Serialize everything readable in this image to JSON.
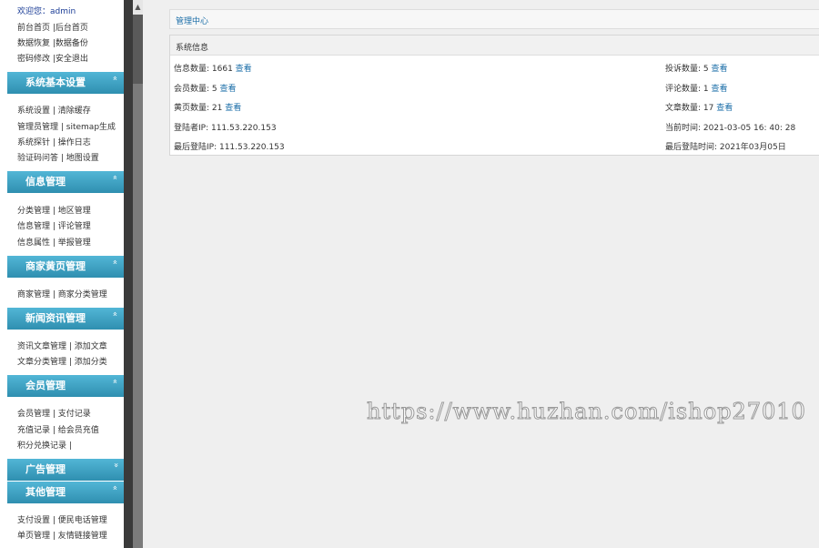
{
  "sidebar": {
    "welcome_prefix": "欢迎您：",
    "welcome_user": "admin",
    "top_links": [
      [
        "前台首页",
        "后台首页"
      ],
      [
        "数据恢复",
        "数据备份"
      ],
      [
        "密码修改",
        "安全退出"
      ]
    ],
    "sections": [
      {
        "title": "系统基本设置",
        "links": [
          [
            "系统设置",
            "清除缓存"
          ],
          [
            "管理员管理",
            "sitemap生成"
          ],
          [
            "系统探针",
            "操作日志"
          ],
          [
            "验证码问答",
            "地图设置"
          ]
        ]
      },
      {
        "title": "信息管理",
        "links": [
          [
            "分类管理",
            "地区管理"
          ],
          [
            "信息管理",
            "评论管理"
          ],
          [
            "信息属性",
            "举报管理"
          ]
        ]
      },
      {
        "title": "商家黄页管理",
        "links": [
          [
            "商家管理",
            "商家分类管理"
          ]
        ]
      },
      {
        "title": "新闻资讯管理",
        "links": [
          [
            "资讯文章管理",
            "添加文章"
          ],
          [
            "文章分类管理",
            "添加分类"
          ]
        ]
      },
      {
        "title": "会员管理",
        "links": [
          [
            "会员管理",
            "支付记录"
          ],
          [
            "充值记录",
            "给会员充值"
          ],
          [
            "积分兑换记录",
            ""
          ]
        ]
      },
      {
        "title": "广告管理",
        "links": []
      },
      {
        "title": "其他管理",
        "links": [
          [
            "支付设置",
            "便民电话管理"
          ],
          [
            "单页管理",
            "友情链接管理"
          ]
        ]
      }
    ],
    "chevron_up": "»",
    "chevron_down": "»"
  },
  "main": {
    "header_title": "管理中心",
    "panel_title": "系统信息",
    "view_label": "查看",
    "rows": [
      {
        "left_label": "信息数量: 1661 ",
        "left_link": "查看",
        "right_label": "投诉数量: 5 ",
        "right_link": "查看"
      },
      {
        "left_label": "会员数量: 5 ",
        "left_link": "查看",
        "right_label": "评论数量: 1 ",
        "right_link": "查看"
      },
      {
        "left_label": "黄页数量: 21 ",
        "left_link": "查看",
        "right_label": "文章数量: 17 ",
        "right_link": "查看"
      },
      {
        "left_label": "登陆者IP: 111.53.220.153",
        "left_link": "",
        "right_label": "当前时间: 2021-03-05 16: 40: 28",
        "right_link": ""
      },
      {
        "left_label": "最后登陆IP: 111.53.220.153",
        "left_link": "",
        "right_label": "最后登陆时间: 2021年03月05日",
        "right_link": ""
      }
    ]
  },
  "watermark": "https://www.huzhan.com/ishop27010",
  "colors": {
    "section_header": "#2f8fb0",
    "link": "#1b6ea8",
    "scrollbar": "#3a3a3a"
  }
}
